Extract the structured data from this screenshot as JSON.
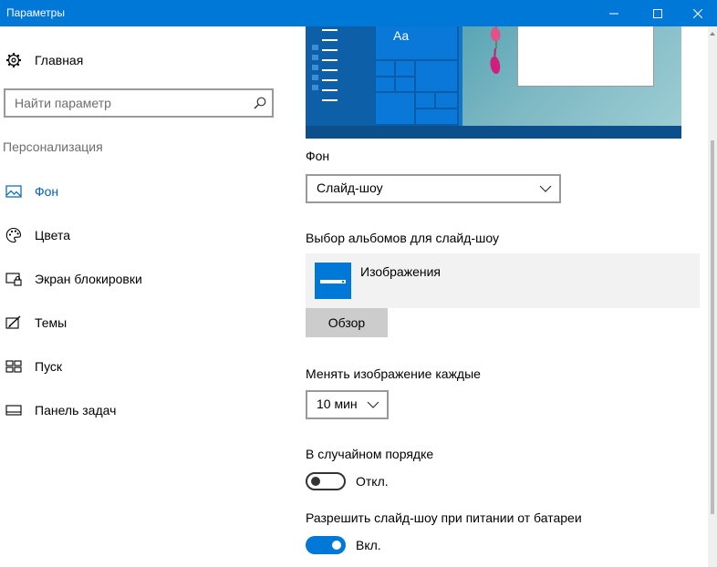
{
  "window": {
    "title": "Параметры"
  },
  "sidebar": {
    "home_label": "Главная",
    "search_placeholder": "Найти параметр",
    "section_title": "Персонализация",
    "items": [
      {
        "label": "Фон",
        "icon": "picture-icon",
        "active": true
      },
      {
        "label": "Цвета",
        "icon": "palette-icon",
        "active": false
      },
      {
        "label": "Экран блокировки",
        "icon": "lock-screen-icon",
        "active": false
      },
      {
        "label": "Темы",
        "icon": "themes-icon",
        "active": false
      },
      {
        "label": "Пуск",
        "icon": "start-icon",
        "active": false
      },
      {
        "label": "Панель задач",
        "icon": "taskbar-icon",
        "active": false
      }
    ]
  },
  "main": {
    "preview": {
      "sample_text": "Aa"
    },
    "background": {
      "label": "Фон",
      "value": "Слайд-шоу"
    },
    "albums": {
      "label": "Выбор альбомов для слайд-шоу",
      "album_name": "Изображения",
      "browse_label": "Обзор"
    },
    "interval": {
      "label": "Менять изображение каждые",
      "value": "10 мин"
    },
    "shuffle": {
      "label": "В случайном порядке",
      "state_label": "Откл.",
      "on": false
    },
    "battery": {
      "label": "Разрешить слайд-шоу при питании от батареи",
      "state_label": "Вкл.",
      "on": true
    }
  },
  "colors": {
    "accent": "#0078d7",
    "active_nav_text": "#0063b1"
  }
}
